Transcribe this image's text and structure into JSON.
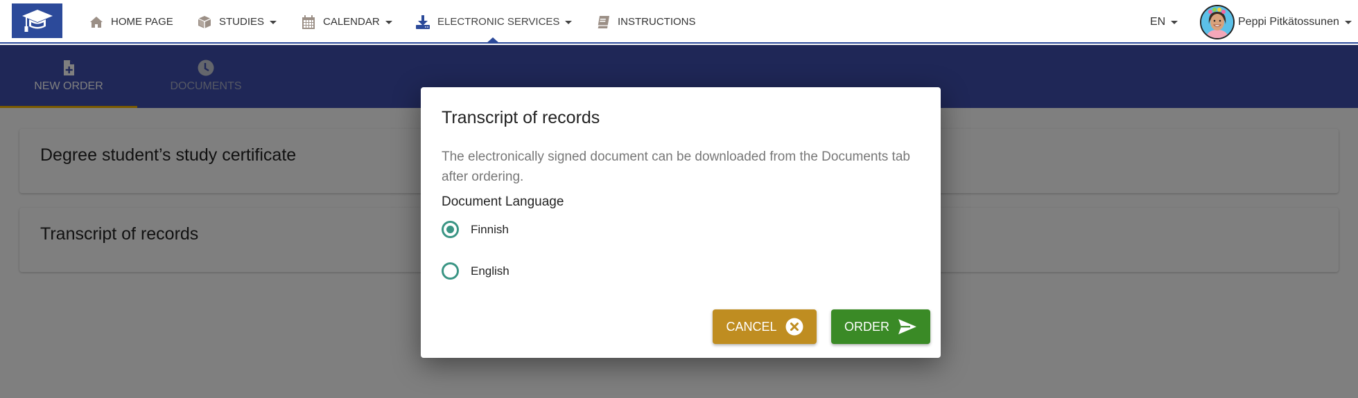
{
  "navbar": {
    "items": [
      {
        "label": "HOME PAGE",
        "icon": "home-icon",
        "dropdown": false
      },
      {
        "label": "STUDIES",
        "icon": "cube-icon",
        "dropdown": true
      },
      {
        "label": "CALENDAR",
        "icon": "calendar-icon",
        "dropdown": true
      },
      {
        "label": "ELECTRONIC SERVICES",
        "icon": "download-icon",
        "dropdown": true,
        "active": true
      },
      {
        "label": "INSTRUCTIONS",
        "icon": "book-icon",
        "dropdown": false
      }
    ],
    "language": "EN",
    "user_name": "Peppi Pitkätossunen"
  },
  "tabs": [
    {
      "label": "NEW ORDER",
      "icon": "file-plus-icon",
      "active": true
    },
    {
      "label": "DOCUMENTS",
      "icon": "clock-icon",
      "active": false
    }
  ],
  "cards": [
    {
      "title": "Degree student’s study certificate"
    },
    {
      "title": "Transcript of records"
    }
  ],
  "modal": {
    "title": "Transcript of records",
    "description": "The electronically signed document can be downloaded from the Documents tab after ordering.",
    "language_label": "Document Language",
    "options": [
      {
        "label": "Finnish",
        "checked": true
      },
      {
        "label": "English",
        "checked": false
      }
    ],
    "cancel_label": "CANCEL",
    "order_label": "ORDER"
  },
  "colors": {
    "brand_blue": "#2c4a9a",
    "tab_bar": "#3e4eae",
    "tab_active_underline": "#f5b400",
    "radio_accent": "#3a9584",
    "cancel_button": "#bf8d21",
    "order_button": "#3a8a26"
  }
}
